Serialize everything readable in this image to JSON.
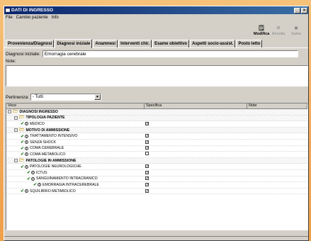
{
  "window": {
    "title": "DATI DI INGRESSO"
  },
  "menu": [
    "File",
    "Cambio paziente",
    "Info"
  ],
  "toolbar": {
    "modifica": "Modifica",
    "annulla": "Annulla",
    "salva": "Salva"
  },
  "tabs": [
    "Provenienza/Diagnosi",
    "Diagnosi iniziale",
    "Anamnesi",
    "Interventi chir.",
    "Esame obiettivo",
    "Aspetti socio-assist.",
    "Posto letto"
  ],
  "form": {
    "diagnosi_label": "Diagnosi iniziale:",
    "diagnosi_value": "Emorragia cerebrale",
    "note_label": "Note:",
    "pertinenza_label": "Pertinenza:",
    "pertinenza_value": "- Tutti"
  },
  "grid": {
    "headers": [
      "Voce",
      "Specifica",
      "Note"
    ],
    "rows": [
      {
        "label": "DIAGNOSI INGRESSO",
        "level": 0,
        "group": true,
        "checked": null
      },
      {
        "label": "TIPOLOGIA PAZIENTE",
        "level": 1,
        "group": true,
        "checked": null
      },
      {
        "label": "MEDICO",
        "level": 2,
        "group": false,
        "checked": true
      },
      {
        "label": "MOTIVO DI AMMISSIONE",
        "level": 1,
        "group": true,
        "checked": null
      },
      {
        "label": "TRATTAMENTO INTENSIVO",
        "level": 2,
        "group": false,
        "checked": true
      },
      {
        "label": "SENZA SHOCK",
        "level": 2,
        "group": false,
        "checked": true
      },
      {
        "label": "COMA CEREBRALE",
        "level": 2,
        "group": false,
        "checked": true
      },
      {
        "label": "COMA METABOLICO",
        "level": 2,
        "group": false,
        "checked": false
      },
      {
        "label": "PATOLOGIE IN AMMISSIONE",
        "level": 1,
        "group": true,
        "checked": null
      },
      {
        "label": "PATOLOGIE NEUROLOGICHE",
        "level": 2,
        "group": false,
        "checked": true
      },
      {
        "label": "ICTUS",
        "level": 3,
        "group": false,
        "checked": true
      },
      {
        "label": "SANGUINAMENTO INTRACRANICO",
        "level": 3,
        "group": false,
        "checked": true
      },
      {
        "label": "EMORRAGIA INTRACEREBRALE",
        "level": 4,
        "group": false,
        "checked": true
      },
      {
        "label": "SQUILIBRIO METABOLICO",
        "level": 2,
        "group": false,
        "checked": true
      }
    ]
  }
}
